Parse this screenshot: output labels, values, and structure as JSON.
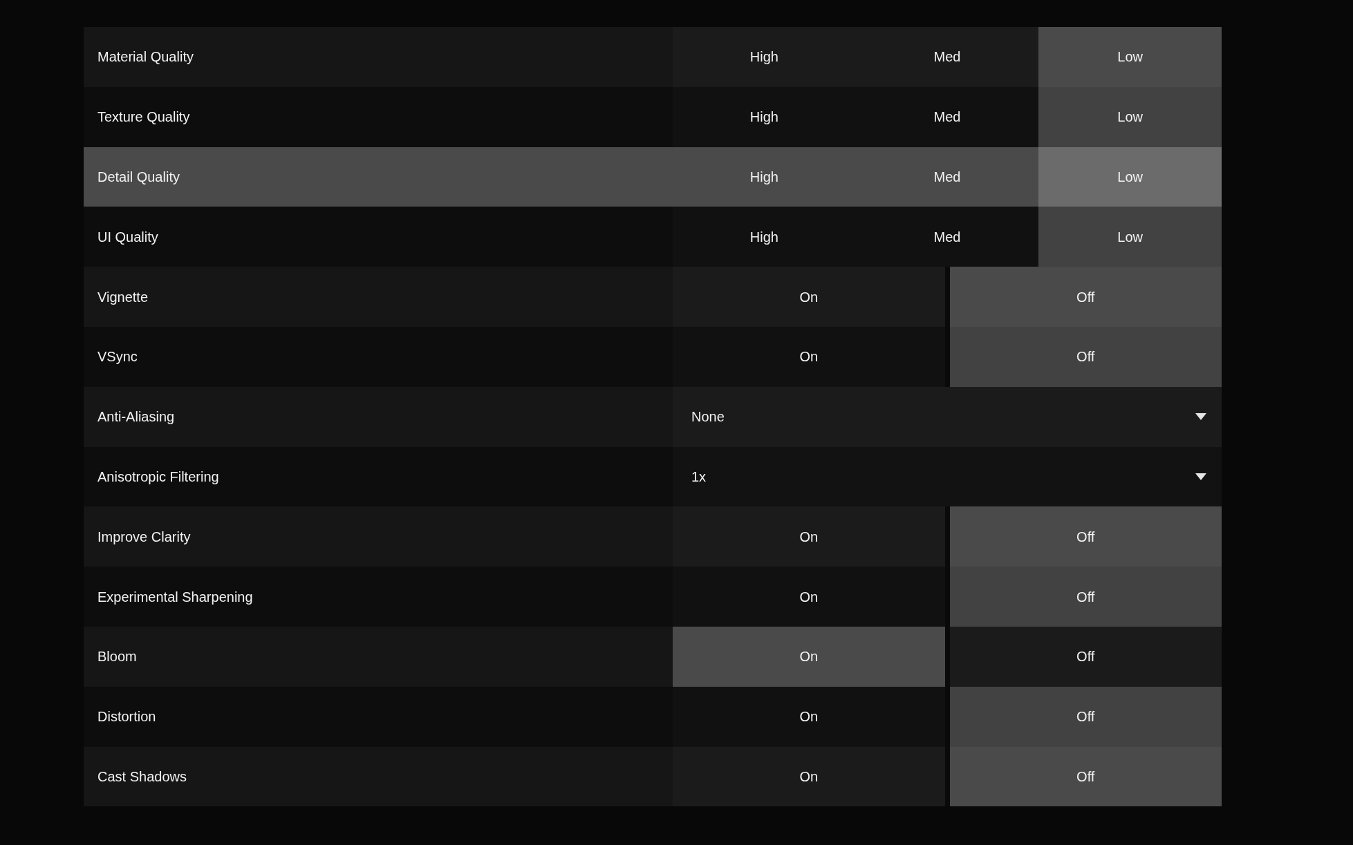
{
  "settings": [
    {
      "label": "Material Quality",
      "kind": "choice",
      "highlighted": false,
      "options": [
        {
          "label": "High",
          "selected": false
        },
        {
          "label": "Med",
          "selected": false
        },
        {
          "label": "Low",
          "selected": true
        }
      ]
    },
    {
      "label": "Texture Quality",
      "kind": "choice",
      "highlighted": false,
      "options": [
        {
          "label": "High",
          "selected": false
        },
        {
          "label": "Med",
          "selected": false
        },
        {
          "label": "Low",
          "selected": true
        }
      ]
    },
    {
      "label": "Detail Quality",
      "kind": "choice",
      "highlighted": true,
      "options": [
        {
          "label": "High",
          "selected": false
        },
        {
          "label": "Med",
          "selected": false
        },
        {
          "label": "Low",
          "selected": true
        }
      ]
    },
    {
      "label": "UI Quality",
      "kind": "choice",
      "highlighted": false,
      "options": [
        {
          "label": "High",
          "selected": false
        },
        {
          "label": "Med",
          "selected": false
        },
        {
          "label": "Low",
          "selected": true
        }
      ]
    },
    {
      "label": "Vignette",
      "kind": "choice",
      "highlighted": false,
      "options": [
        {
          "label": "On",
          "selected": false
        },
        {
          "label": "Off",
          "selected": true
        }
      ]
    },
    {
      "label": "VSync",
      "kind": "choice",
      "highlighted": false,
      "options": [
        {
          "label": "On",
          "selected": false
        },
        {
          "label": "Off",
          "selected": true
        }
      ]
    },
    {
      "label": "Anti-Aliasing",
      "kind": "dropdown",
      "highlighted": false,
      "value": "None"
    },
    {
      "label": "Anisotropic Filtering",
      "kind": "dropdown",
      "highlighted": false,
      "value": "1x"
    },
    {
      "label": "Improve Clarity",
      "kind": "choice",
      "highlighted": false,
      "options": [
        {
          "label": "On",
          "selected": false
        },
        {
          "label": "Off",
          "selected": true
        }
      ]
    },
    {
      "label": "Experimental Sharpening",
      "kind": "choice",
      "highlighted": false,
      "options": [
        {
          "label": "On",
          "selected": false
        },
        {
          "label": "Off",
          "selected": true
        }
      ]
    },
    {
      "label": "Bloom",
      "kind": "choice",
      "highlighted": false,
      "options": [
        {
          "label": "On",
          "selected": true
        },
        {
          "label": "Off",
          "selected": false
        }
      ]
    },
    {
      "label": "Distortion",
      "kind": "choice",
      "highlighted": false,
      "options": [
        {
          "label": "On",
          "selected": false
        },
        {
          "label": "Off",
          "selected": true
        }
      ]
    },
    {
      "label": "Cast Shadows",
      "kind": "choice",
      "highlighted": false,
      "options": [
        {
          "label": "On",
          "selected": false
        },
        {
          "label": "Off",
          "selected": true
        }
      ]
    }
  ]
}
